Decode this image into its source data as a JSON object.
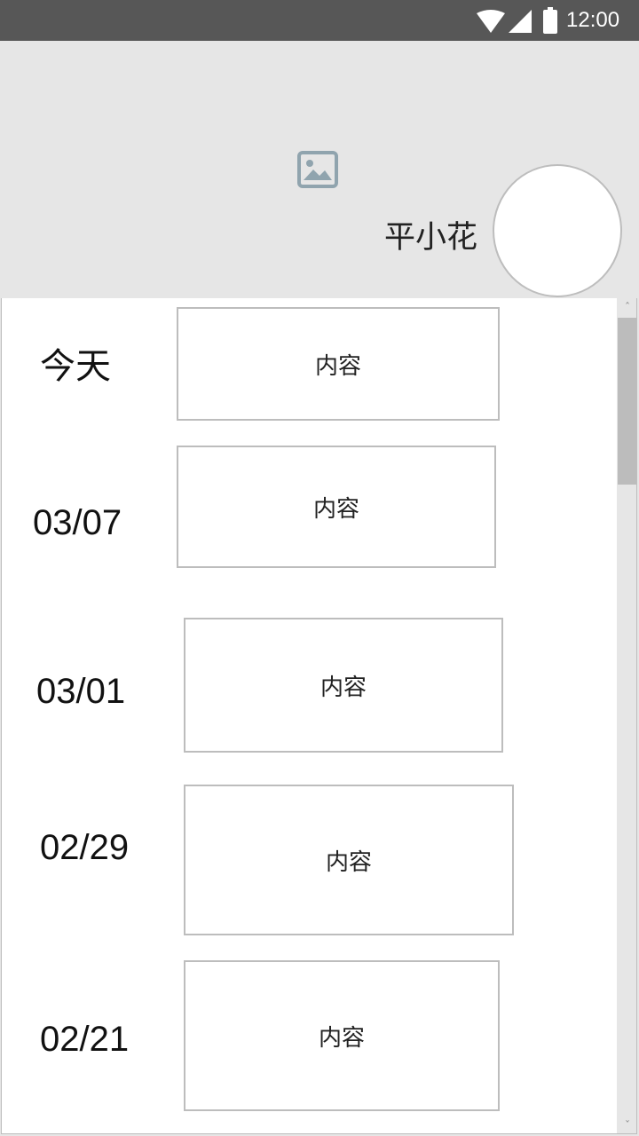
{
  "status_bar": {
    "time": "12:00",
    "icons": [
      "wifi-icon",
      "cellular-signal-icon",
      "battery-icon"
    ]
  },
  "header": {
    "cover_icon": "image-placeholder-icon",
    "user_name": "平小花",
    "avatar_icon": "avatar-placeholder"
  },
  "timeline": {
    "entries": [
      {
        "date": "今天",
        "content": "内容"
      },
      {
        "date": "03/07",
        "content": "内容"
      },
      {
        "date": "03/01",
        "content": "内容"
      },
      {
        "date": "02/29",
        "content": "内容"
      },
      {
        "date": "02/21",
        "content": "内容"
      }
    ]
  },
  "colors": {
    "status_bar_bg": "#575757",
    "page_bg": "#e6e6e6",
    "border": "#bdbdbd",
    "image_icon": "#90a4ae"
  }
}
